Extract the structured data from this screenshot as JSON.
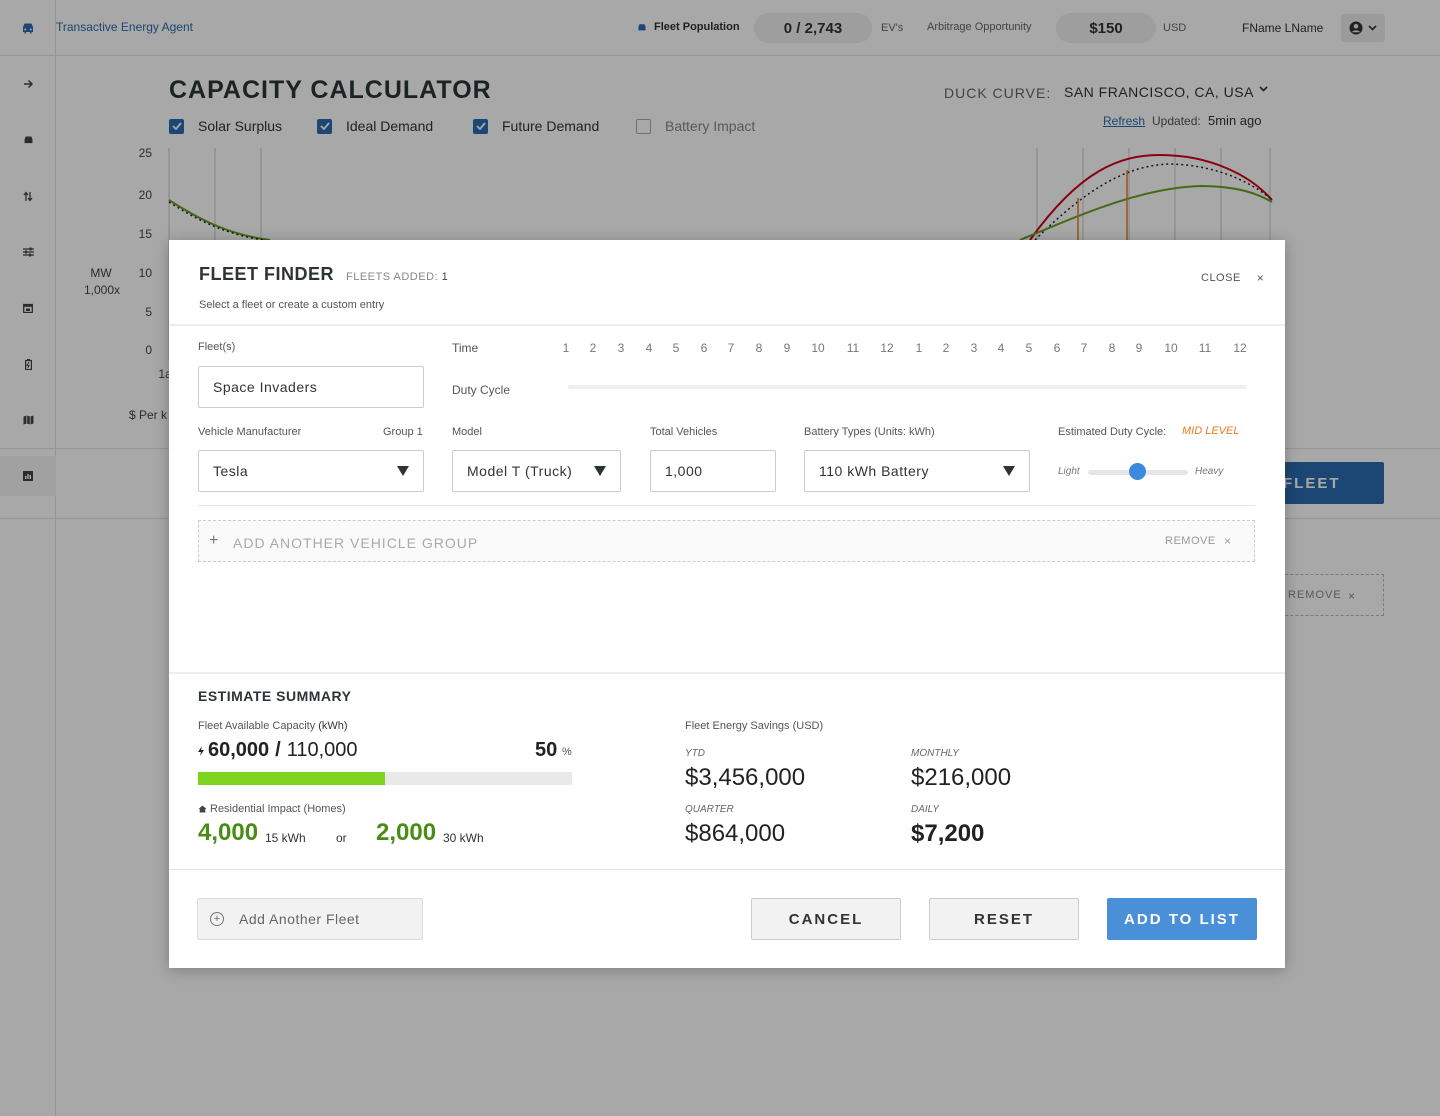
{
  "header": {
    "app_title": "Transactive Energy Agent",
    "fleet_population_label": "Fleet Population",
    "fleet_population_value": "0 / 2,743",
    "fleet_population_unit": "EV's",
    "arbitrage_label": "Arbitrage Opportunity",
    "arbitrage_value": "$150",
    "arbitrage_unit": "USD",
    "user_name": "FName LName"
  },
  "sidebar": {
    "items": [
      "arrow-right-icon",
      "car-icon",
      "swap-icon",
      "sliders-icon",
      "calendar-icon",
      "battery-icon",
      "map-icon",
      "chart-icon"
    ]
  },
  "calculator": {
    "title": "CAPACITY CALCULATOR",
    "duck_curve_label": "DUCK CURVE:",
    "duck_curve_value": "SAN FRANCISCO, CA, USA",
    "refresh_label": "Refresh",
    "updated_label": "Updated:",
    "updated_value": "5min ago",
    "legend": [
      {
        "label": "Solar Surplus",
        "checked": true
      },
      {
        "label": "Ideal Demand",
        "checked": true
      },
      {
        "label": "Future Demand",
        "checked": true
      },
      {
        "label": "Battery Impact",
        "checked": false
      }
    ],
    "y_ticks": [
      "25",
      "20",
      "15",
      "10",
      "5",
      "0"
    ],
    "y_unit_1": "MW",
    "y_unit_2": "1,000x",
    "x_partial": "1a",
    "per_label": "$ Per k",
    "add_fleet_label": "D FLEET",
    "remove_label": "REMOVE",
    "remove_x": "×"
  },
  "modal": {
    "title": "FLEET FINDER",
    "fleets_added_label": "FLEETS ADDED:",
    "fleets_added_value": "1",
    "subtitle": "Select a fleet or create a custom entry",
    "close_label": "CLOSE",
    "close_x": "×",
    "fleets_label": "Fleet(s)",
    "fleet_name": "Space Invaders",
    "time_label": "Time",
    "time_numbers": [
      "1",
      "2",
      "3",
      "4",
      "5",
      "6",
      "7",
      "8",
      "9",
      "10",
      "11",
      "12",
      "1",
      "2",
      "3",
      "4",
      "5",
      "6",
      "7",
      "8",
      "9",
      "10",
      "11",
      "12"
    ],
    "duty_cycle_label": "Duty Cycle",
    "manufacturer_label": "Vehicle Manufacturer",
    "group_label": "Group 1",
    "manufacturer_value": "Tesla",
    "model_label": "Model",
    "model_value": "Model T (Truck)",
    "total_label": "Total Vehicles",
    "total_value": "1,000",
    "battery_label": "Battery Types (Units: kWh)",
    "battery_value": "110 kWh Battery",
    "est_duty_label": "Estimated Duty Cycle:",
    "est_duty_value": "MID LEVEL",
    "slider_light": "Light",
    "slider_heavy": "Heavy",
    "duty_slider_level": 0.5,
    "add_group_plus": "+",
    "add_group_label": "ADD ANOTHER VEHICLE GROUP",
    "add_group_remove": "REMOVE",
    "add_group_x": "×"
  },
  "summary": {
    "title": "ESTIMATE SUMMARY",
    "capacity_label": "Fleet Available Capacity",
    "capacity_unit": "(kWh)",
    "capacity_available": "60,000",
    "capacity_sep": "/",
    "capacity_total": "110,000",
    "capacity_pct": "50",
    "capacity_pct_unit": "%",
    "capacity_fill_fraction": 0.5,
    "residential_label": "Residential Impact (Homes)",
    "res_value_1": "4,000",
    "res_unit_1": "15 kWh",
    "res_or": "or",
    "res_value_2": "2,000",
    "res_unit_2": "30 kWh",
    "savings_label": "Fleet Energy Savings (USD)",
    "ytd_label": "YTD",
    "ytd_value": "$3,456,000",
    "monthly_label": "MONTHLY",
    "monthly_value": "$216,000",
    "quarter_label": "QUARTER",
    "quarter_value": "$864,000",
    "daily_label": "DAILY",
    "daily_value": "$7,200"
  },
  "footer": {
    "add_fleet_label": "Add Another Fleet",
    "cancel_label": "CANCEL",
    "reset_label": "RESET",
    "add_to_list_label": "ADD TO LIST"
  },
  "colors": {
    "primary": "#2b6cb0",
    "button_blue": "#4a90d9",
    "capacity_green": "#7ed321",
    "residential_green": "#4a8c16",
    "mid_level_orange": "#e67e22",
    "curve_red": "#d0021b",
    "curve_green": "#6aa121"
  }
}
